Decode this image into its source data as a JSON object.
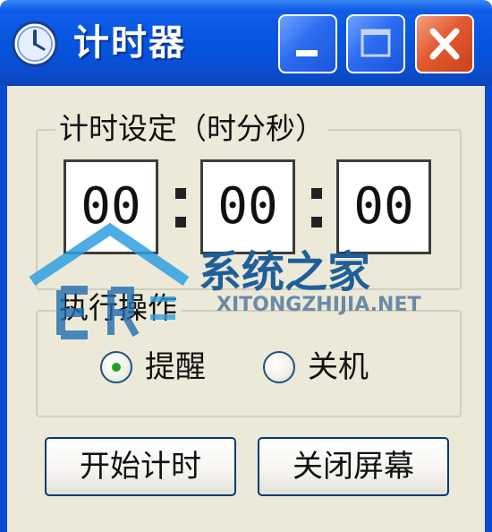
{
  "window": {
    "title": "计时器",
    "icon": "clock-icon",
    "controls": {
      "minimize": "minimize-icon",
      "maximize": "maximize-icon",
      "close": "close-icon"
    },
    "colors": {
      "titlebar": "#0654de",
      "close": "#e35a30",
      "client": "#ece9d8"
    }
  },
  "timer": {
    "group_label": "计时设定（时分秒）",
    "hours": "00",
    "minutes": "00",
    "seconds": "00",
    "separator": ":"
  },
  "action": {
    "group_label": "执行操作",
    "options": [
      {
        "label": "提醒",
        "selected": true
      },
      {
        "label": "关机",
        "selected": false
      }
    ]
  },
  "buttons": {
    "start": "开始计时",
    "close_screen": "关闭屏幕"
  },
  "watermark": {
    "text": "系统之家",
    "url": "XITONGZHIJIA.NET"
  }
}
